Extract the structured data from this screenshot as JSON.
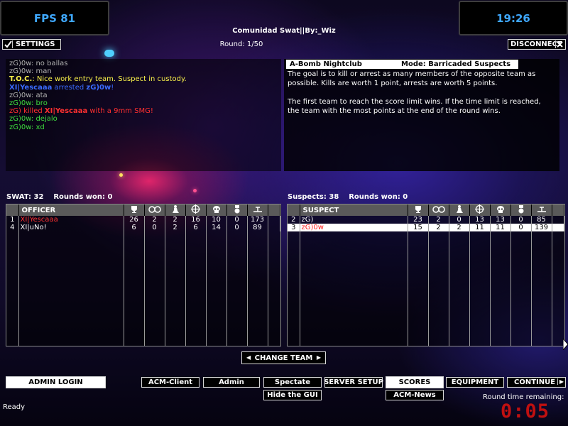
{
  "hud": {
    "fps": "FPS 81",
    "clock": "19:26"
  },
  "server": {
    "name": "Comunidad Swat||By:_Wiz",
    "round": "Round: 1/50"
  },
  "topbar": {
    "settings_label": "SETTINGS",
    "disconnect_label": "DISCONNECT"
  },
  "chat": [
    {
      "segments": [
        {
          "t": "zG)0w",
          "c": "gray"
        },
        {
          "t": ": no ballas",
          "c": "gray"
        }
      ]
    },
    {
      "segments": [
        {
          "t": "zG)0w",
          "c": "gray"
        },
        {
          "t": ": man",
          "c": "gray"
        }
      ]
    },
    {
      "segments": [
        {
          "t": "T.O.C.",
          "c": "yellow",
          "b": true
        },
        {
          "t": ": Nice work entry team.  Suspect in custody.",
          "c": "yellow"
        }
      ]
    },
    {
      "segments": [
        {
          "t": "XI|Yescaaa",
          "c": "blue",
          "b": true
        },
        {
          "t": " arrested ",
          "c": "blue"
        },
        {
          "t": "zG)0w",
          "c": "blue",
          "b": true
        },
        {
          "t": "!",
          "c": "blue"
        }
      ]
    },
    {
      "segments": [
        {
          "t": "zG)0w",
          "c": "gray"
        },
        {
          "t": ": ata",
          "c": "gray"
        }
      ]
    },
    {
      "segments": [
        {
          "t": "zG)0w",
          "c": "green"
        },
        {
          "t": ": bro",
          "c": "green"
        }
      ]
    },
    {
      "segments": [
        {
          "t": "zG)",
          "c": "red"
        },
        {
          "t": " killed ",
          "c": "red"
        },
        {
          "t": "XI|Yescaaa",
          "c": "red",
          "b": true
        },
        {
          "t": " with a 9mm SMG!",
          "c": "red"
        }
      ]
    },
    {
      "segments": [
        {
          "t": "zG)0w",
          "c": "green"
        },
        {
          "t": ": dejalo",
          "c": "green"
        }
      ]
    },
    {
      "segments": [
        {
          "t": "zG)0w",
          "c": "green"
        },
        {
          "t": ": xd",
          "c": "green"
        }
      ]
    }
  ],
  "info": {
    "map": "A-Bomb Nightclub",
    "mode": "Mode: Barricaded Suspects",
    "p1": "The goal is to kill or arrest as many members of the opposite team as possible.  Kills are worth 1 point, arrests are worth 5 points.",
    "p2": "The first team to reach the score limit wins.  If the time limit is reached, the team with the most points at the end of the round wins."
  },
  "swat": {
    "header": "SWAT: 32    Rounds won: 0",
    "col_label": "OFFICER",
    "rows": [
      {
        "n": "1",
        "name": "XI|Yescaaa",
        "red": true,
        "v": [
          "26",
          "2",
          "2",
          "16",
          "10",
          "0",
          "173"
        ]
      },
      {
        "n": "4",
        "name": "XI|uNo!",
        "red": false,
        "v": [
          "6",
          "0",
          "2",
          "6",
          "14",
          "0",
          "89"
        ]
      }
    ]
  },
  "suspects": {
    "header": "Suspects: 38    Rounds won: 0",
    "col_label": "SUSPECT",
    "rows": [
      {
        "n": "2",
        "name": "zG)",
        "sel": false,
        "v": [
          "23",
          "2",
          "0",
          "13",
          "13",
          "0",
          "85"
        ]
      },
      {
        "n": "3",
        "name": "zG)0w",
        "sel": true,
        "v": [
          "15",
          "2",
          "2",
          "11",
          "11",
          "0",
          "139"
        ]
      }
    ]
  },
  "icons": [
    "trophy-icon",
    "arrest-icon",
    "cuffed-icon",
    "crosshair-icon",
    "skull-icon",
    "medal-icon",
    "ping-icon"
  ],
  "change_team": "CHANGE TEAM",
  "bottom": {
    "admin_login": "ADMIN LOGIN",
    "acm_client": "ACM-Client",
    "admin": "Admin",
    "spectate": "Spectate",
    "server_setup": "SERVER SETUP",
    "scores": "SCORES",
    "equipment": "EQUIPMENT",
    "continue": "CONTINUE",
    "hide_gui": "Hide the GUI",
    "acm_news": "ACM-News",
    "round_time_label": "Round time remaining:",
    "round_time": "0:05",
    "status": "Ready"
  },
  "colors": {
    "hud_blue": "#3fa8ff",
    "timer_red": "#c01010",
    "kill_red": "#ff3030",
    "chat_green": "#3fdc3f",
    "toc_yellow": "#f8f04a"
  }
}
